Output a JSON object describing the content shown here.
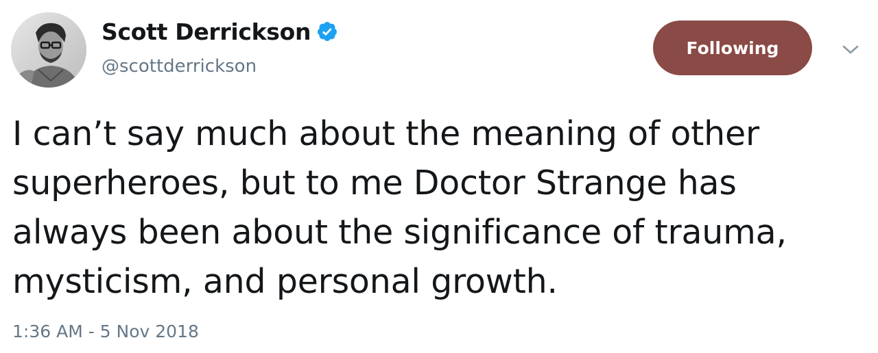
{
  "author": {
    "display_name": "Scott Derrickson",
    "handle": "@scottderrickson",
    "verified": true,
    "avatar_icon": "profile-photo"
  },
  "follow_button": {
    "label": "Following",
    "color": "#8a4a46"
  },
  "menu_icon": "chevron-down-icon",
  "tweet": {
    "lines": [
      "I can’t say much about the meaning of other",
      "superheroes, but to me Doctor Strange has",
      "always been about the significance of trauma,",
      "mysticism, and personal growth."
    ],
    "timestamp": "1:36 AM - 5 Nov 2018"
  },
  "colors": {
    "verified_badge": "#1da1f2",
    "secondary_text": "#657786",
    "primary_text": "#14171a"
  }
}
